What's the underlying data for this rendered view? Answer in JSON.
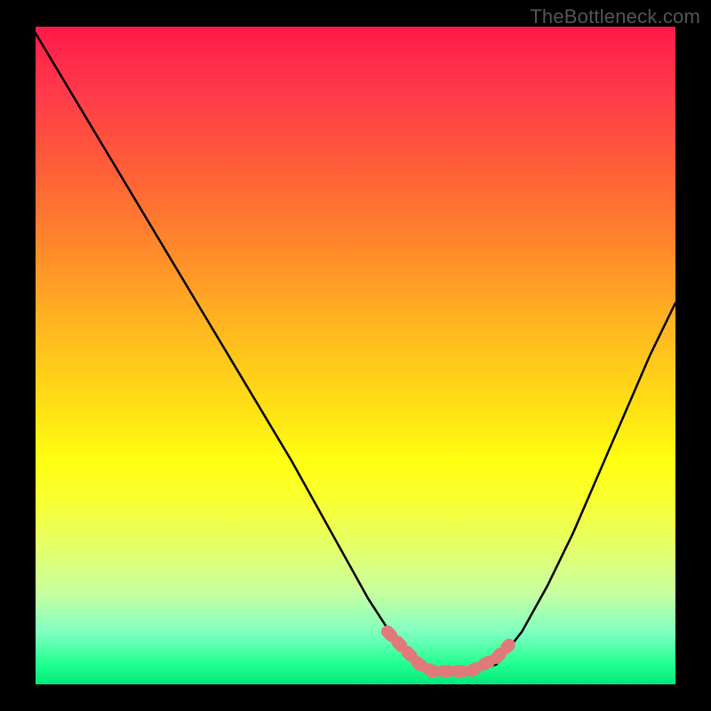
{
  "watermark": "TheBottleneck.com",
  "chart_data": {
    "type": "line",
    "title": "",
    "xlabel": "",
    "ylabel": "",
    "xlim": [
      0,
      100
    ],
    "ylim": [
      0,
      100
    ],
    "grid": false,
    "legend": false,
    "series": [
      {
        "name": "curve",
        "color": "#000000",
        "x": [
          0,
          8,
          16,
          24,
          32,
          40,
          48,
          52,
          56,
          60,
          62,
          64,
          68,
          72,
          76,
          80,
          84,
          88,
          92,
          96,
          100
        ],
        "y": [
          99,
          86,
          73,
          60,
          47,
          34,
          20,
          13,
          7,
          3,
          2,
          2,
          2,
          3,
          8,
          15,
          23,
          32,
          41,
          50,
          58
        ]
      }
    ],
    "highlight": {
      "name": "bottom-highlight",
      "color": "#e07a7a",
      "x": [
        55,
        58,
        60,
        62,
        64,
        66,
        68,
        70,
        72,
        74
      ],
      "y": [
        8,
        5,
        3,
        2,
        2,
        2,
        2,
        3,
        4,
        6
      ]
    },
    "background_gradient": {
      "type": "vertical",
      "stops": [
        {
          "pos": 0,
          "color": "#ff1a4a"
        },
        {
          "pos": 50,
          "color": "#ffb820"
        },
        {
          "pos": 70,
          "color": "#ffff10"
        },
        {
          "pos": 100,
          "color": "#00e878"
        }
      ]
    }
  }
}
